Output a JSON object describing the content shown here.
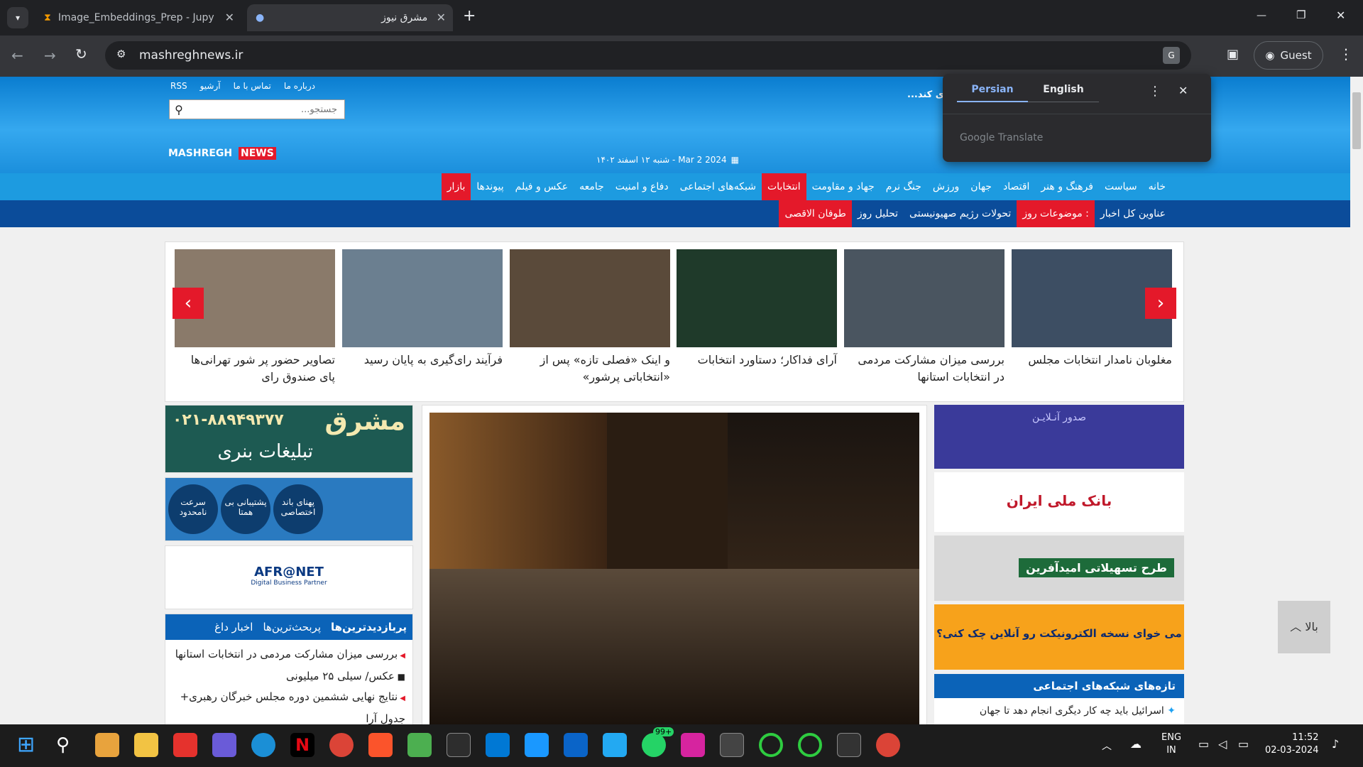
{
  "tabs": [
    {
      "title": "Image_Embeddings_Prep - Jupy"
    },
    {
      "title": "مشرق نیوز"
    }
  ],
  "address": "mashreghnews.ir",
  "profile": "Guest",
  "translate_popup": {
    "lang1": "Persian",
    "lang2": "English",
    "brand": "Google Translate"
  },
  "site": {
    "toplinks": [
      "درباره ما",
      "تماس با ما",
      "آرشیو",
      "RSS"
    ],
    "search_placeholder": "جستجو...",
    "logo_main": "MASHREGH",
    "logo_accent": "NEWS",
    "tagline": "...ی کند",
    "date": "شنبه ۱۲ اسفند ۱۴۰۲ - Mar 2 2024",
    "nav_main": [
      "خانه",
      "سیاست",
      "فرهنگ و هنر",
      "اقتصاد",
      "جهان",
      "ورزش",
      "جنگ نرم",
      "جهاد و مقاومت",
      "انتخابات",
      "شبکه‌های اجتماعی",
      "دفاع و امنیت",
      "جامعه",
      "عکس و فیلم",
      "پیوندها",
      "بازار"
    ],
    "nav_sub": [
      "عناوین کل اخبار",
      "موضوعات روز :",
      "تحولات رژیم صهیونیستی",
      "تحلیل روز",
      "طوفان الاقصی"
    ],
    "slides": [
      "مغلوبان نامدار انتخابات مجلس",
      "بررسی میزان مشارکت مردمی در انتخابات استانها",
      "آرای فداکار؛ دستاورد انتخابات",
      "و اینک «فصلی تازه» پس از «انتخاباتی پرشور»",
      "فرآیند رای‌گیری به پایان رسید",
      "تصاویر حضور پر شور تهرانی‌ها پای صندوق رای"
    ],
    "ad1_title": "مشرق",
    "ad1_sub": "تبلیغات بنری",
    "ad1_phone": "۰۲۱-۸۸۹۴۹۳۷۷",
    "ad2_items": [
      "سرعت نامحدود",
      "پشتیبانی بی همتا",
      "پهنای باند اختصاصی"
    ],
    "ad3_title": "AFR@NET",
    "ad3_sub": "Digital Business Partner",
    "left_tabs": [
      "پربازدیدترین‌ها",
      "پربحث‌ترین‌ها",
      "اخبار داغ"
    ],
    "left_items": [
      "بررسی میزان مشارکت مردمی در انتخابات استانها",
      "عکس/ سیلی ۲۵ میلیونی",
      "نتایج نهایی ششمین دوره مجلس خبرگان رهبری+ جدول آرا"
    ],
    "right_ads": [
      "صدور آنـلایـن",
      "بانک ملی ایران",
      "طرح تسهیلاتی امیدآفرین",
      "می خوای نسخه الکترونیکت رو آنلاین چک کنی؟"
    ],
    "social_head": "تازه‌های شبکه‌های اجتماعی",
    "social_item": "اسرائیل باید چه کار دیگری انجام دهد تا جهان",
    "top_button": "بالا"
  },
  "taskbar": {
    "lang1": "ENG",
    "lang2": "IN",
    "time": "11:52",
    "date": "02-03-2024",
    "badge": "99+"
  }
}
